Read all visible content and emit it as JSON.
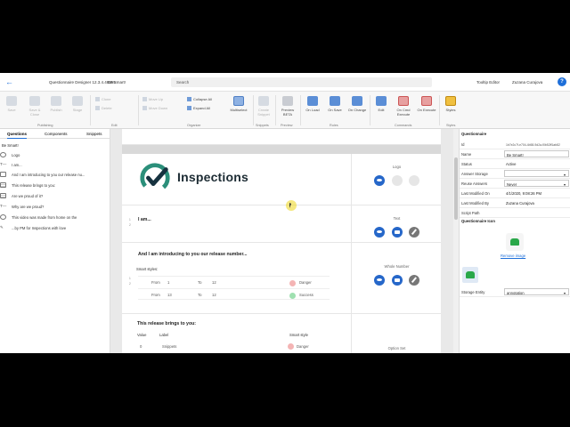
{
  "titlebar": {
    "app_title": "Questionnaire Designer 12.3.4.48255",
    "doc_title": "Be Smart!",
    "search_placeholder": "Search",
    "tooltips": "Tooltip Editor",
    "user": "Zuzana Curajova",
    "help": "?"
  },
  "ribbon": {
    "save": "Save",
    "save_close": "Save & Close",
    "publish": "Publish",
    "stage": "Stage",
    "clone": "Clone",
    "delete": "Delete",
    "move_up": "Move Up",
    "move_down": "Move Down",
    "collapse_all": "Collapse All",
    "expand_all": "Expand All",
    "multiselect": "Multiselect",
    "create_snippet": "Create Snippet",
    "preview_beta": "Preview BETA",
    "on_load": "On Load",
    "on_save": "On Save",
    "on_change": "On Change",
    "edit": "Edit",
    "on_cmd_execute": "On Cmd Execute",
    "on_execute": "On Execute",
    "styles": "Styles",
    "groups": {
      "publishing": "Publishing",
      "edit": "Edit",
      "organize": "Organize",
      "snippets": "Snippets",
      "preview": "Preview",
      "rules": "Rules",
      "commands": "Commands",
      "styles": "Styles"
    }
  },
  "left": {
    "tabs": [
      "Questions",
      "Components",
      "Snippets"
    ],
    "root": "Be Smart!",
    "items": [
      "Logo",
      "I am...",
      "And I am introducing to you our release nu...",
      "This release brings to you:",
      "Are we proud of it?",
      "Why are we proud?",
      "This video was made from home on the",
      "...by PM for Inspections with love"
    ]
  },
  "canvas": {
    "brand": "Inspections",
    "q_iam": "I am...",
    "q_release": "And I am introducing to you our release number...",
    "smart_styles": "Smart styles:",
    "ranges": [
      {
        "from_label": "From",
        "from": "1",
        "to_label": "To",
        "to": "12",
        "style": "Danger"
      },
      {
        "from_label": "From",
        "from": "13",
        "to_label": "To",
        "to": "12",
        "style": "Success"
      }
    ],
    "q_brings": "This release brings to you:",
    "cols": {
      "value": "Value",
      "label": "Label",
      "smart": "Smart style"
    },
    "table_row": {
      "value": "0",
      "label": "Snippets",
      "style": "Danger"
    },
    "side_labels": {
      "logo": "Logo",
      "text": "Text",
      "whole": "Whole Number",
      "option": "Option Set"
    },
    "row_nums": {
      "r1": "1",
      "r2": "2"
    }
  },
  "right": {
    "header": "Questionnaire",
    "props": [
      {
        "k": "Id",
        "v": "1b7e2c7f-e704-4b58-9d2a-f0b52ff1ab82",
        "small": true
      },
      {
        "k": "Name",
        "v": "Be Smart!",
        "box": true
      },
      {
        "k": "Status",
        "v": "Active"
      },
      {
        "k": "Answer Storage",
        "v": "",
        "box": true,
        "caret": true
      },
      {
        "k": "Reuse Answers",
        "v": "Never",
        "box": true,
        "caret": true
      },
      {
        "k": "Last Modified On",
        "v": "4/1/2020, 9:08:26 PM"
      },
      {
        "k": "Last Modified By",
        "v": "Zuzana Curajova"
      },
      {
        "k": "Script Path",
        "v": ""
      }
    ],
    "icon_header": "Questionnaire Icon",
    "remove_image": "Remove image",
    "storage_entity": {
      "k": "Storage Entity",
      "v": "annotation"
    }
  },
  "colors": {
    "accent": "#1e6fd9",
    "danger": "#f4b4b4",
    "success": "#9fe0b0",
    "brand_green": "#2aa84a"
  }
}
